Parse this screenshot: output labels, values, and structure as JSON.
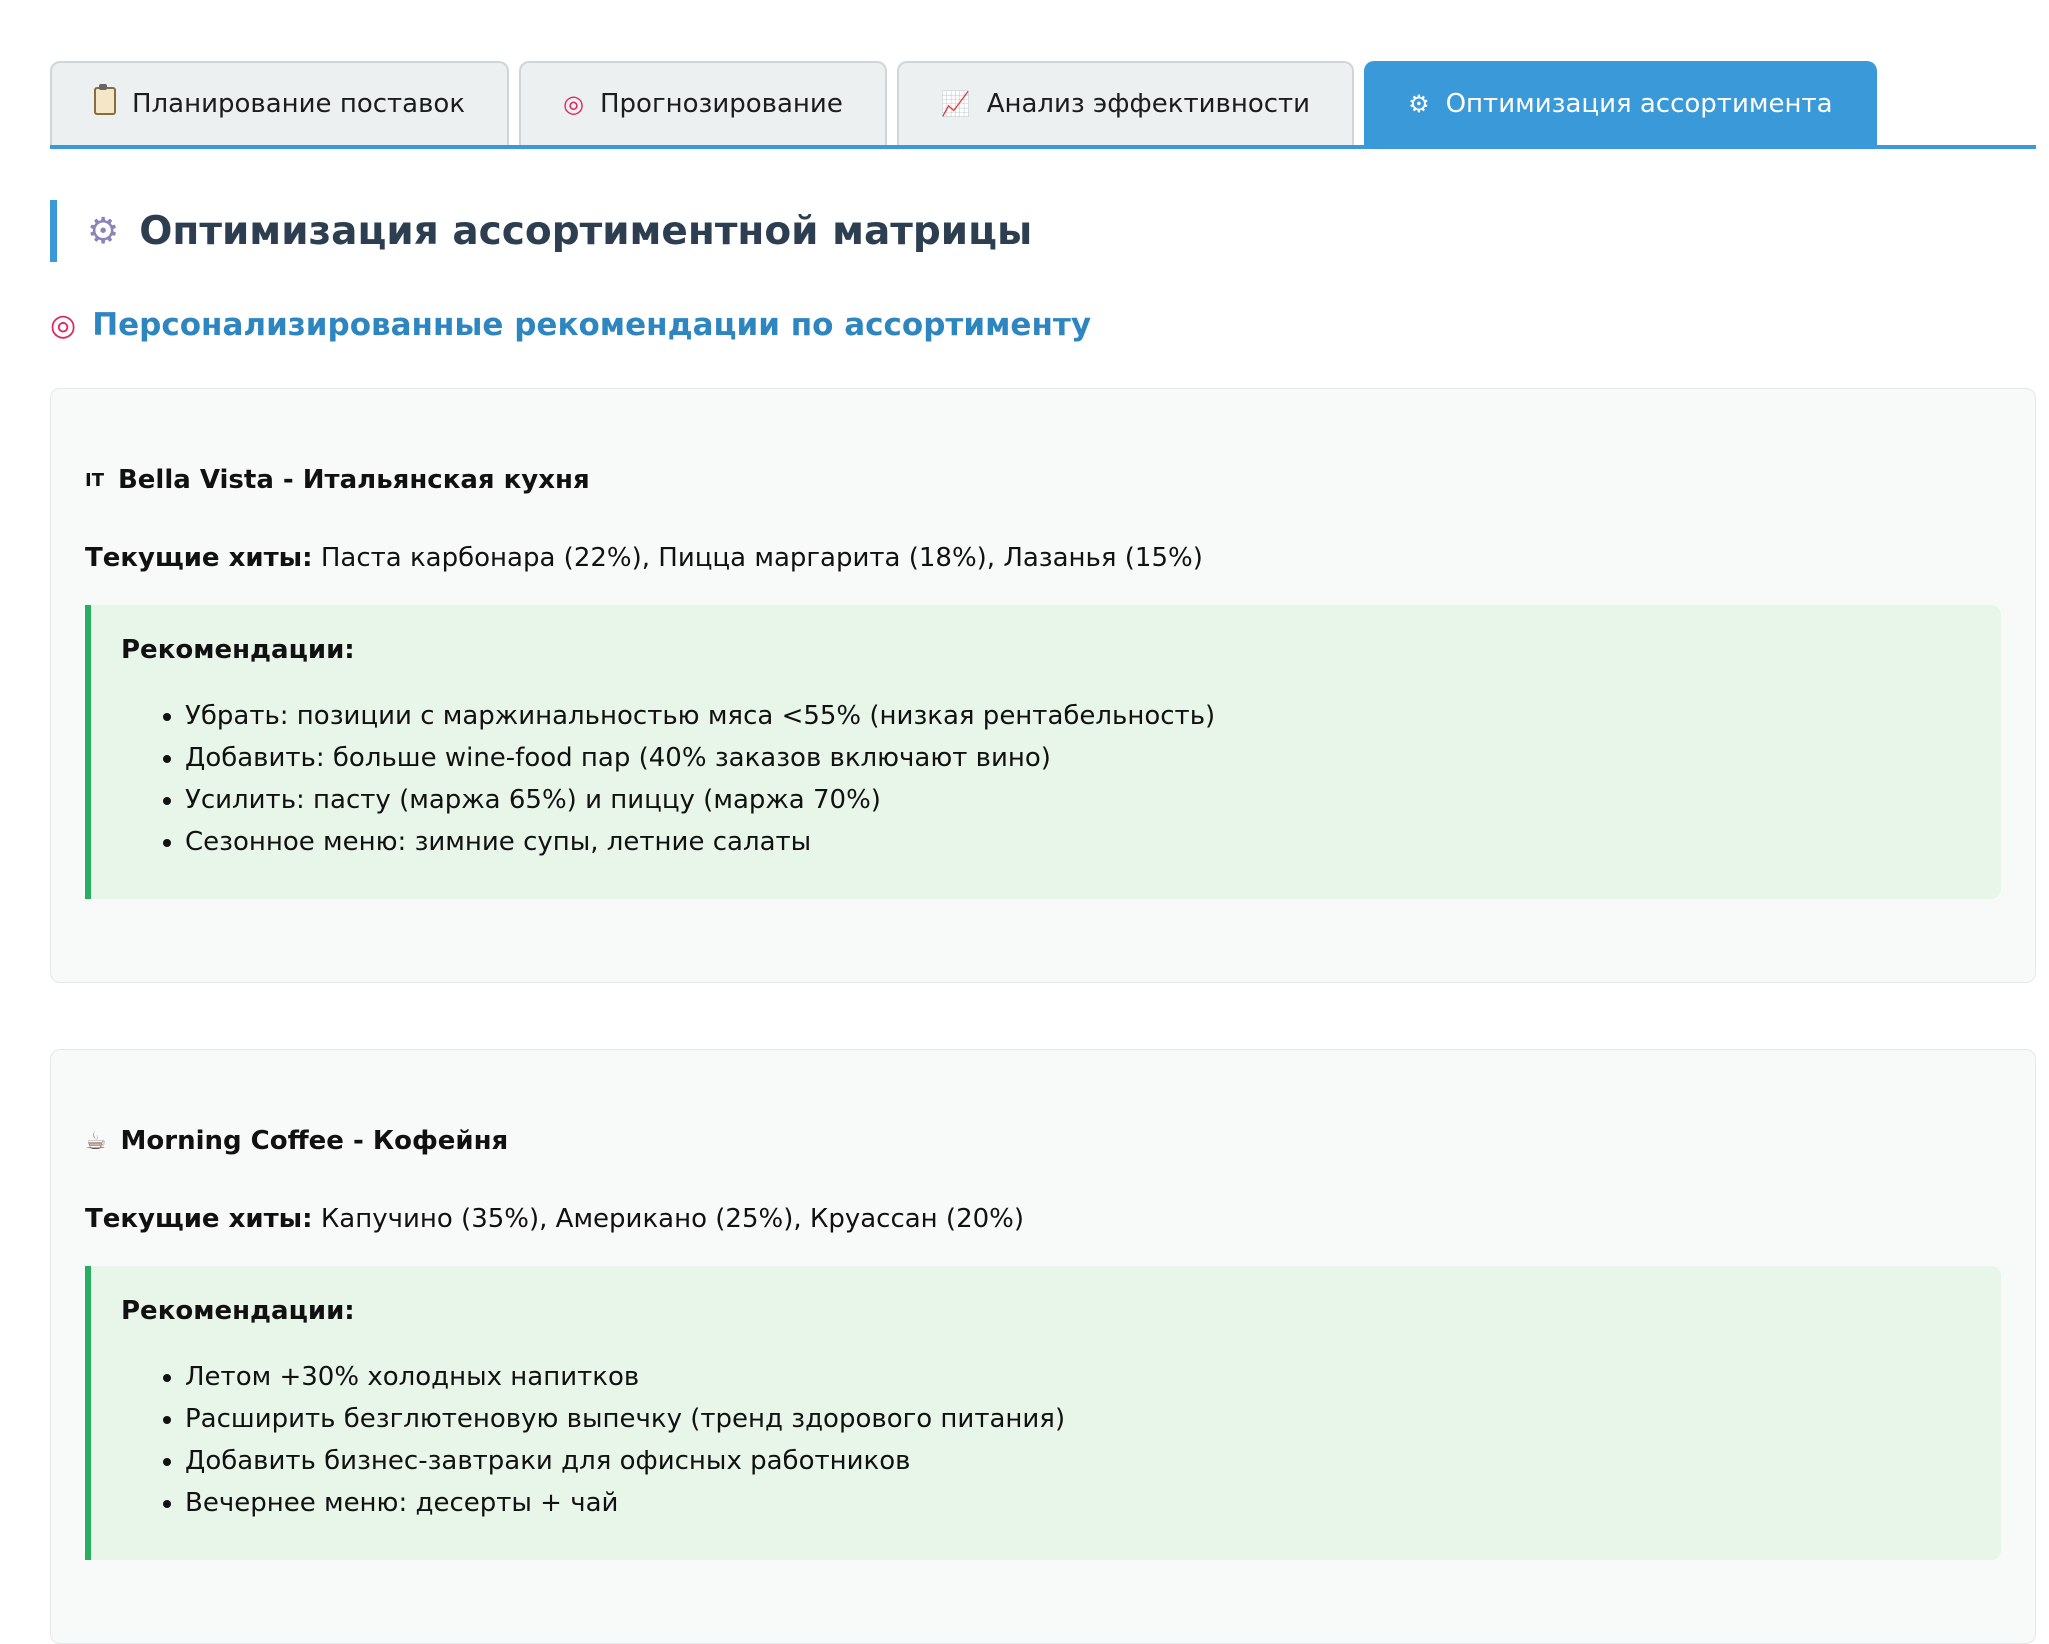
{
  "tabs": [
    {
      "icon": "clipboard-icon",
      "label": "Планирование поставок",
      "active": false
    },
    {
      "icon": "target-icon",
      "label": "Прогнозирование",
      "active": false
    },
    {
      "icon": "chart-increasing-icon",
      "label": "Анализ эффективности",
      "active": false
    },
    {
      "icon": "gear-icon",
      "label": "Оптимизация ассортимента",
      "active": true
    }
  ],
  "page": {
    "title": "Оптимизация ассортиментной матрицы",
    "subtitle": "Персонализированные рекомендации по ассортименту"
  },
  "restaurants": [
    {
      "icon": "italy-flag-icon",
      "icon_text": "IT",
      "name": "Bella Vista - Итальянская кухня",
      "hits_label": "Текущие хиты:",
      "hits": "Паста карбонара (22%), Пицца маргарита (18%), Лазанья (15%)",
      "rec_title": "Рекомендации:",
      "recommendations": [
        "Убрать: позиции с маржинальностью мяса <55% (низкая рентабельность)",
        "Добавить: больше wine-food пар (40% заказов включают вино)",
        "Усилить: пасту (маржа 65%) и пиццу (маржа 70%)",
        "Сезонное меню: зимние супы, летние салаты"
      ]
    },
    {
      "icon": "coffee-icon",
      "icon_text": "☕",
      "name": "Morning Coffee - Кофейня",
      "hits_label": "Текущие хиты:",
      "hits": "Капучино (35%), Американо (25%), Круассан (20%)",
      "rec_title": "Рекомендации:",
      "recommendations": [
        "Летом +30% холодных напитков",
        "Расширить безглютеновую выпечку (тренд здорового питания)",
        "Добавить бизнес-завтраки для офисных работников",
        "Вечернее меню: десерты + чай"
      ]
    }
  ],
  "colors": {
    "accent": "#3a9ad9",
    "heading": "#2c3e50",
    "subheading": "#2e86c1",
    "rec_border": "#27ae60",
    "rec_bg": "#e8f5e9"
  }
}
